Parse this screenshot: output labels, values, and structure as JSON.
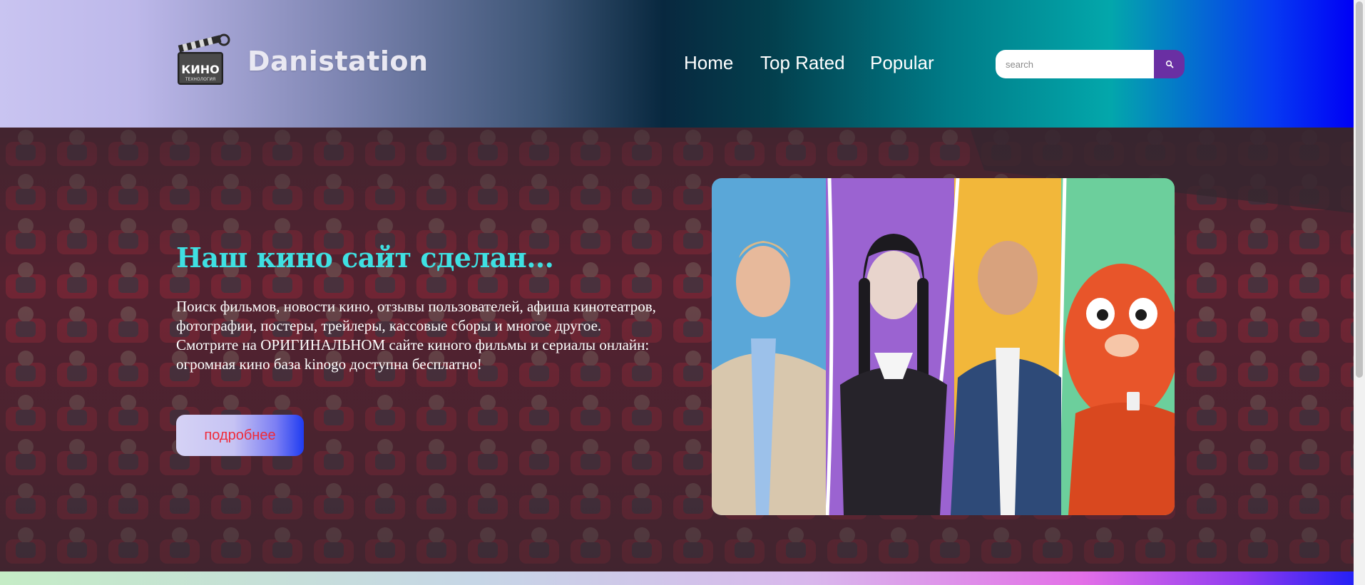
{
  "header": {
    "logo_text": "КИНО",
    "logo_subtext": "ТЕХНОЛОГИЯ",
    "brand": "Danistation",
    "nav": [
      {
        "label": "Home"
      },
      {
        "label": "Top Rated"
      },
      {
        "label": "Popular"
      }
    ],
    "search": {
      "placeholder": "search"
    }
  },
  "hero": {
    "title": "Наш кино сайт сделан...",
    "paragraphs": [
      "Поиск фильмов, новости кино, отзывы пользователей, афиша кинотеатров, фотографии, постеры, трейлеры, кассовые сборы и многое другое.",
      "Смотрите на ОРИГИНАЛЬНОМ сайте киного фильмы и сериалы онлайн: огромная кино база kinogo доступна бесплатно!"
    ],
    "button_label": "подробнее"
  },
  "icons": {
    "logo": "clapperboard-icon",
    "search": "search-icon"
  },
  "colors": {
    "title": "#3fe0e2",
    "button_text": "#ef2b3a",
    "search_button": "#6a2fa3"
  }
}
